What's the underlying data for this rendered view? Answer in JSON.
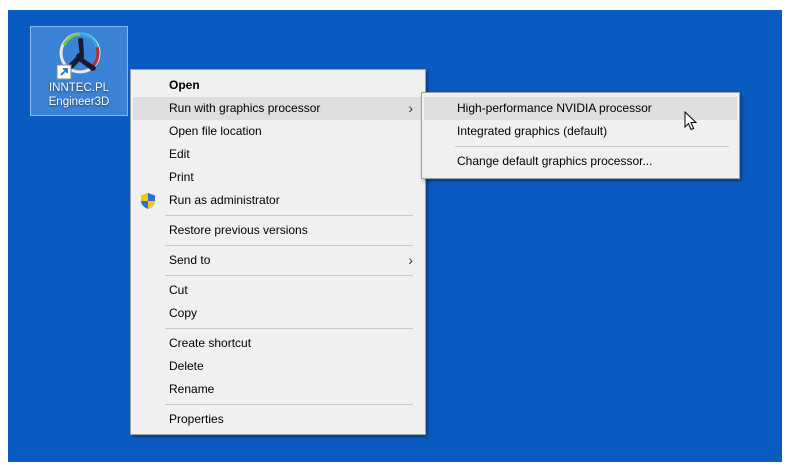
{
  "desktop": {
    "background": "#0a5cc2",
    "icon": {
      "name_line1": "INNTEC.PL",
      "name_line2": "Engineer3D",
      "icon": "app-shortcut-icon"
    }
  },
  "context_menu": {
    "items": [
      {
        "label": "Open"
      },
      {
        "label": "Run with graphics processor",
        "arrow": "›"
      },
      {
        "label": "Open file location"
      },
      {
        "label": "Edit"
      },
      {
        "label": "Print"
      },
      {
        "label": "Run as administrator",
        "icon": "shield-icon"
      },
      {
        "label": "Restore previous versions"
      },
      {
        "label": "Send to",
        "arrow": "›"
      },
      {
        "label": "Cut"
      },
      {
        "label": "Copy"
      },
      {
        "label": "Create shortcut"
      },
      {
        "label": "Delete"
      },
      {
        "label": "Rename"
      },
      {
        "label": "Properties"
      }
    ]
  },
  "submenu": {
    "items": [
      {
        "label": "High-performance NVIDIA processor"
      },
      {
        "label": "Integrated graphics (default)"
      },
      {
        "label": "Change default graphics processor..."
      }
    ]
  }
}
